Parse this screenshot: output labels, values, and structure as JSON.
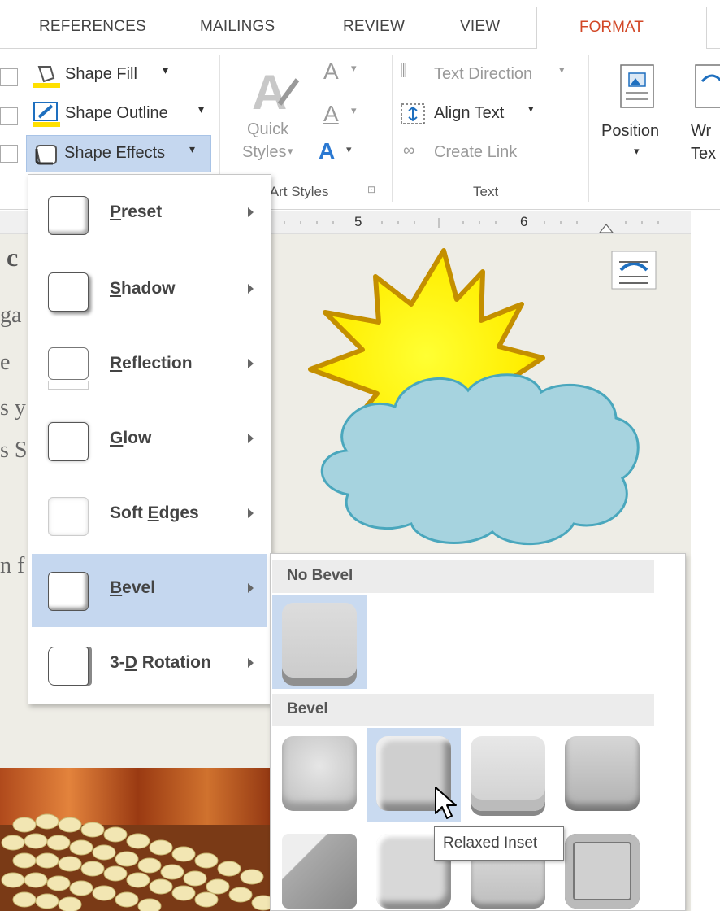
{
  "tabs": {
    "references": "REFERENCES",
    "mailings": "MAILINGS",
    "review": "REVIEW",
    "view": "VIEW",
    "format": "FORMAT"
  },
  "ribbon": {
    "shape_fill": "Shape Fill",
    "shape_outline": "Shape Outline",
    "shape_effects": "Shape Effects",
    "quick_styles_line1": "Quick",
    "quick_styles_line2": "Styles",
    "wordart_group": "lArt Styles",
    "text_direction": "Text Direction",
    "align_text": "Align Text",
    "create_link": "Create Link",
    "text_group": "Text",
    "position": "Position",
    "wrap_text_line1": "Wr",
    "wrap_text_line2": "Tex"
  },
  "ruler": {
    "mark5": "5",
    "mark6": "6"
  },
  "document": {
    "fragments": [
      "c",
      "ga",
      "e",
      "s y",
      "s S",
      "n f"
    ]
  },
  "shape_effects_menu": {
    "items": [
      {
        "label": "Preset",
        "key": "P"
      },
      {
        "label": "Shadow",
        "key": "S"
      },
      {
        "label": "Reflection",
        "key": "R"
      },
      {
        "label": "Glow",
        "key": "G"
      },
      {
        "label": "Soft Edges",
        "key": "E"
      },
      {
        "label": "Bevel",
        "key": "B"
      },
      {
        "label": "3-D Rotation",
        "key": "D"
      }
    ],
    "active_item": "Bevel"
  },
  "bevel_submenu": {
    "no_bevel_header": "No Bevel",
    "bevel_header": "Bevel",
    "tooltip": "Relaxed Inset"
  },
  "colors": {
    "format_tab": "#d24726",
    "menu_highlight": "#c5d7ef",
    "sun": "#ffee00",
    "cloud": "#a6d3df"
  }
}
